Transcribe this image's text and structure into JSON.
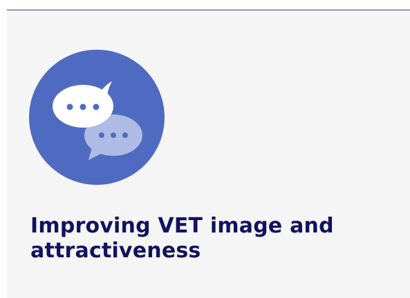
{
  "card": {
    "title": "Improving VET image and attractiveness",
    "icon": "chat-bubbles-icon"
  },
  "colors": {
    "card_background": "#f5f5f5",
    "icon_circle": "#4f6bc1",
    "title_text": "#12135e",
    "top_rule": "#2f3f86"
  }
}
